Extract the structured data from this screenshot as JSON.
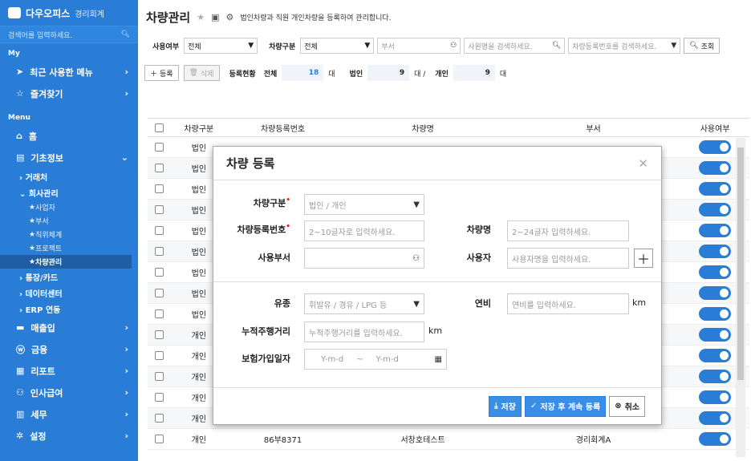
{
  "sidebar": {
    "brand_name": "다우오피스",
    "brand_sub": "경리회계",
    "search_placeholder": "검색어를 입력하세요.",
    "section_my": "My",
    "my_items": [
      {
        "label": "최근 사용한 메뉴",
        "icon": "send-icon"
      },
      {
        "label": "즐겨찾기",
        "icon": "star-icon"
      }
    ],
    "section_menu": "Menu",
    "home": "홈",
    "basic_info": "기초정보",
    "sub_client": "› 거래처",
    "sub_company": "⌄ 회사관리",
    "leaves": [
      "사업자",
      "부서",
      "직위체계",
      "프로젝트",
      "차량관리"
    ],
    "sub_bank": "› 통장/카드",
    "sub_datacenter": "› 데이터센터",
    "sub_erp": "› ERP 연동",
    "bottom_items": [
      {
        "label": "매출입",
        "icon": "card-icon"
      },
      {
        "label": "금융",
        "icon": "won-icon"
      },
      {
        "label": "리포트",
        "icon": "report-icon"
      },
      {
        "label": "인사급여",
        "icon": "people-icon"
      },
      {
        "label": "세무",
        "icon": "calculator-icon"
      },
      {
        "label": "설정",
        "icon": "gear-icon"
      }
    ]
  },
  "header": {
    "title": "차량관리",
    "description": "법인차량과 직원 개인차량을 등록하여 관리합니다."
  },
  "filters": {
    "usage_label": "사용여부",
    "usage_value": "전체",
    "type_label": "차량구분",
    "type_value": "전체",
    "dept_placeholder": "부서",
    "employee_placeholder": "사원명을 검색하세요.",
    "plate_placeholder": "차량등록번호를 검색하세요.",
    "search_button": "조회"
  },
  "actions": {
    "add": "등록",
    "delete": "삭제",
    "status_label": "등록현황",
    "total_label": "전체",
    "total_value": "18",
    "corp_label": "법인",
    "corp_value": "9",
    "personal_label": "개인",
    "personal_value": "9",
    "unit": "대",
    "unit_slash": "대 /"
  },
  "table": {
    "columns": [
      "차량구분",
      "차량등록번호",
      "차량명",
      "부서",
      "사용여부"
    ],
    "rows": [
      {
        "type": "법인",
        "plate": "",
        "name": "",
        "dept": ""
      },
      {
        "type": "법인",
        "plate": "",
        "name": "",
        "dept": ""
      },
      {
        "type": "법인",
        "plate": "",
        "name": "",
        "dept": ""
      },
      {
        "type": "법인",
        "plate": "",
        "name": "",
        "dept": ""
      },
      {
        "type": "법인",
        "plate": "",
        "name": "",
        "dept": ""
      },
      {
        "type": "법인",
        "plate": "",
        "name": "",
        "dept": ""
      },
      {
        "type": "법인",
        "plate": "",
        "name": "",
        "dept": ""
      },
      {
        "type": "법인",
        "plate": "",
        "name": "",
        "dept": ""
      },
      {
        "type": "법인",
        "plate": "",
        "name": "",
        "dept": ""
      },
      {
        "type": "개인",
        "plate": "",
        "name": "",
        "dept": ""
      },
      {
        "type": "개인",
        "plate": "",
        "name": "",
        "dept": ""
      },
      {
        "type": "개인",
        "plate": "",
        "name": "",
        "dept": ""
      },
      {
        "type": "개인",
        "plate": "",
        "name": "",
        "dept": ""
      },
      {
        "type": "개인",
        "plate": "",
        "name": "",
        "dept": ""
      },
      {
        "type": "개인",
        "plate": "86부8371",
        "name": "서창호테스트",
        "dept": "경리회계A"
      }
    ]
  },
  "modal": {
    "title": "차량 등록",
    "type_label": "차량구분",
    "type_placeholder": "법인 / 개인",
    "plate_label": "차량등록번호",
    "plate_placeholder": "2~10글자로 입력하세요.",
    "name_label": "차량명",
    "name_placeholder": "2~24글자 입력하세요.",
    "dept_label": "사용부서",
    "user_label": "사용자",
    "user_placeholder": "사용자명을 입력하세요.",
    "fuel_label": "유종",
    "fuel_placeholder": "휘발유 / 경유 / LPG 등",
    "efficiency_label": "연비",
    "efficiency_placeholder": "연비를 입력하세요.",
    "efficiency_unit": "km",
    "mileage_label": "누적주행거리",
    "mileage_placeholder": "누적주행거리를 입력하세요.",
    "mileage_unit": "km",
    "insurance_label": "보험가입일자",
    "date_from": "Y-m-d",
    "date_sep": "~",
    "date_to": "Y-m-d",
    "save": "저장",
    "save_continue": "저장 후 계속 등록",
    "cancel": "취소",
    "required_mark": "•"
  },
  "colors": {
    "primary": "#2a7dd6",
    "required": "#dd2222"
  }
}
